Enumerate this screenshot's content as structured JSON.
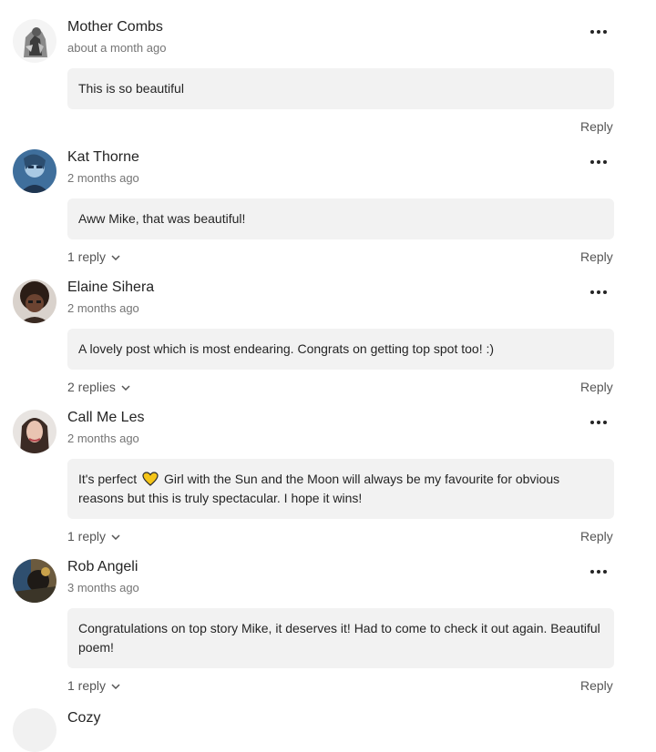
{
  "comments": [
    {
      "name": "Mother Combs",
      "time": "about a month ago",
      "text": "This is so beautiful",
      "reply_label": "Reply",
      "avatar": "avatar-mother-combs"
    },
    {
      "name": "Kat Thorne",
      "time": "2 months ago",
      "text": "Aww Mike, that was beautiful!",
      "replies_label": "1 reply",
      "reply_label": "Reply",
      "avatar": "avatar-kat-thorne"
    },
    {
      "name": "Elaine Sihera",
      "time": "2 months ago",
      "text": "A lovely post which is most endearing. Congrats on getting top spot too! :)",
      "replies_label": "2 replies",
      "reply_label": "Reply",
      "avatar": "avatar-elaine-sihera"
    },
    {
      "name": "Call Me Les",
      "time": "2 months ago",
      "text_before_icon": "It's perfect",
      "icon": "yellow-heart-icon",
      "text_after_icon": "Girl with the Sun and the Moon will always be my favourite for obvious reasons but this is truly spectacular. I hope it wins!",
      "replies_label": "1 reply",
      "reply_label": "Reply",
      "avatar": "avatar-call-me-les"
    },
    {
      "name": "Rob Angeli",
      "time": "3 months ago",
      "text": "Congratulations on top story Mike, it deserves it! Had to come to check it out again. Beautiful poem!",
      "replies_label": "1 reply",
      "reply_label": "Reply",
      "avatar": "avatar-rob-angeli"
    },
    {
      "name": "Cozy",
      "avatar": "avatar-cozy"
    }
  ],
  "colors": {
    "bubble_bg": "#f2f2f2",
    "text": "#242424",
    "muted": "#757575",
    "heart": "#f5c518"
  },
  "icons": [
    "more-options-icon",
    "chevron-down-icon",
    "yellow-heart-icon"
  ]
}
